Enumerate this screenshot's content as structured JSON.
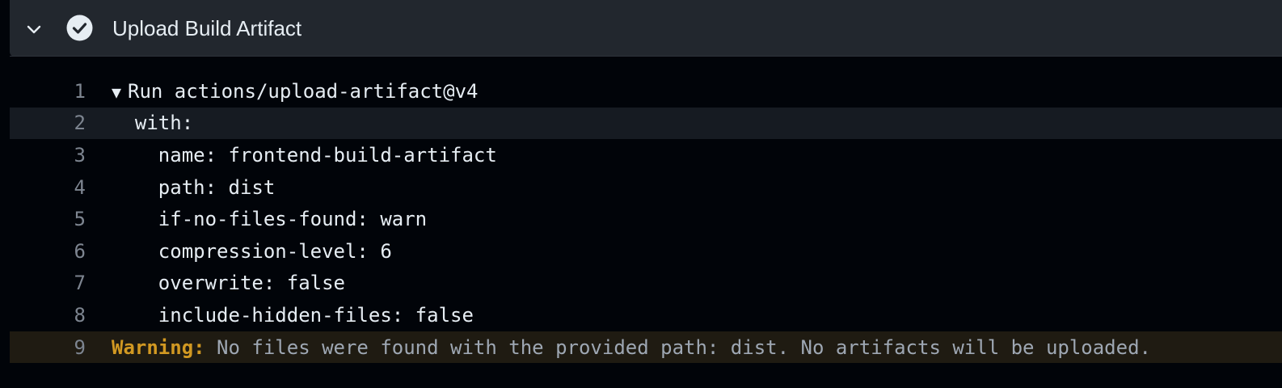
{
  "step": {
    "title": "Upload Build Artifact",
    "status": "success",
    "expanded": true
  },
  "log": {
    "lines": [
      {
        "number": "1",
        "toggle": "▼",
        "text": "Run actions/upload-artifact@v4"
      },
      {
        "number": "2",
        "text": "  with:"
      },
      {
        "number": "3",
        "text": "    name: frontend-build-artifact"
      },
      {
        "number": "4",
        "text": "    path: dist"
      },
      {
        "number": "5",
        "text": "    if-no-files-found: warn"
      },
      {
        "number": "6",
        "text": "    compression-level: 6"
      },
      {
        "number": "7",
        "text": "    overwrite: false"
      },
      {
        "number": "8",
        "text": "    include-hidden-files: false"
      },
      {
        "number": "9",
        "label": "Warning:",
        "text": " No files were found with the provided path: dist. No artifacts will be uploaded."
      }
    ]
  },
  "colors": {
    "background": "#010409",
    "header_bg": "#22272e",
    "text": "#e6edf3",
    "line_number": "#7d8590",
    "warning": "#d29922"
  },
  "icons": {
    "collapse": "chevron-down-icon",
    "status": "check-circle-icon"
  }
}
